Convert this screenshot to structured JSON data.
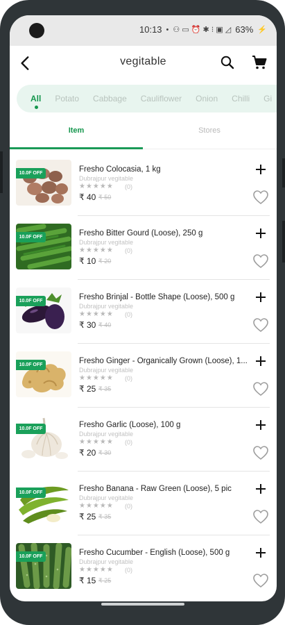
{
  "status_bar": {
    "time": "10:13",
    "dot": "•",
    "small_icons": "⚇ ▭ ⏰ ✱ ⁝ ▣ ◿",
    "battery": "63%",
    "battery_icon": "⚡"
  },
  "app_bar": {
    "title": "vegitable",
    "back_icon": "arrow-back-icon",
    "search_icon": "search-icon",
    "cart_icon": "cart-icon"
  },
  "categories": [
    {
      "label": "All",
      "active": true
    },
    {
      "label": "Potato",
      "active": false
    },
    {
      "label": "Cabbage",
      "active": false
    },
    {
      "label": "Cauliflower",
      "active": false
    },
    {
      "label": "Onion",
      "active": false
    },
    {
      "label": "Chilli",
      "active": false
    },
    {
      "label": "Gi",
      "active": false
    }
  ],
  "tabs": {
    "item": "Item",
    "stores": "Stores"
  },
  "colors": {
    "accent": "#15964d",
    "badge": "#1aa05a",
    "chip_bg": "#e8f5ef"
  },
  "products": [
    {
      "name": "Fresho Colocasia, 1 kg",
      "store": "Dubrajpur vegitable",
      "stars": "★★★★★",
      "rating_count": "(0)",
      "price": "₹ 40",
      "mrp": "₹ 50",
      "badge": "10.0F OFF",
      "image": "colocasia"
    },
    {
      "name": "Fresho Bitter Gourd (Loose), 250 g",
      "store": "Dubrajpur vegitable",
      "stars": "★★★★★",
      "rating_count": "(0)",
      "price": "₹ 10",
      "mrp": "₹ 20",
      "badge": "10.0F OFF",
      "image": "bitter-gourd"
    },
    {
      "name": "Fresho Brinjal - Bottle Shape (Loose), 500 g",
      "store": "Dubrajpur vegitable",
      "stars": "★★★★★",
      "rating_count": "(0)",
      "price": "₹ 30",
      "mrp": "₹ 40",
      "badge": "10.0F OFF",
      "image": "brinjal"
    },
    {
      "name": "Fresho Ginger - Organically Grown (Loose), 1...",
      "store": "Dubrajpur vegitable",
      "stars": "★★★★★",
      "rating_count": "(0)",
      "price": "₹ 25",
      "mrp": "₹ 35",
      "badge": "10.0F OFF",
      "image": "ginger"
    },
    {
      "name": "Fresho Garlic (Loose), 100 g",
      "store": "Dubrajpur vegitable",
      "stars": "★★★★★",
      "rating_count": "(0)",
      "price": "₹ 20",
      "mrp": "₹ 30",
      "badge": "10.0F OFF",
      "image": "garlic"
    },
    {
      "name": "Fresho Banana - Raw Green (Loose), 5 pic",
      "store": "Dubrajpur vegitable",
      "stars": "★★★★★",
      "rating_count": "(0)",
      "price": "₹ 25",
      "mrp": "₹ 35",
      "badge": "10.0F OFF",
      "image": "raw-banana"
    },
    {
      "name": "Fresho Cucumber - English (Loose), 500 g",
      "store": "Dubrajpur vegitable",
      "stars": "★★★★★",
      "rating_count": "(0)",
      "price": "₹ 15",
      "mrp": "₹ 25",
      "badge": "10.0F OFF",
      "image": "cucumber"
    }
  ]
}
